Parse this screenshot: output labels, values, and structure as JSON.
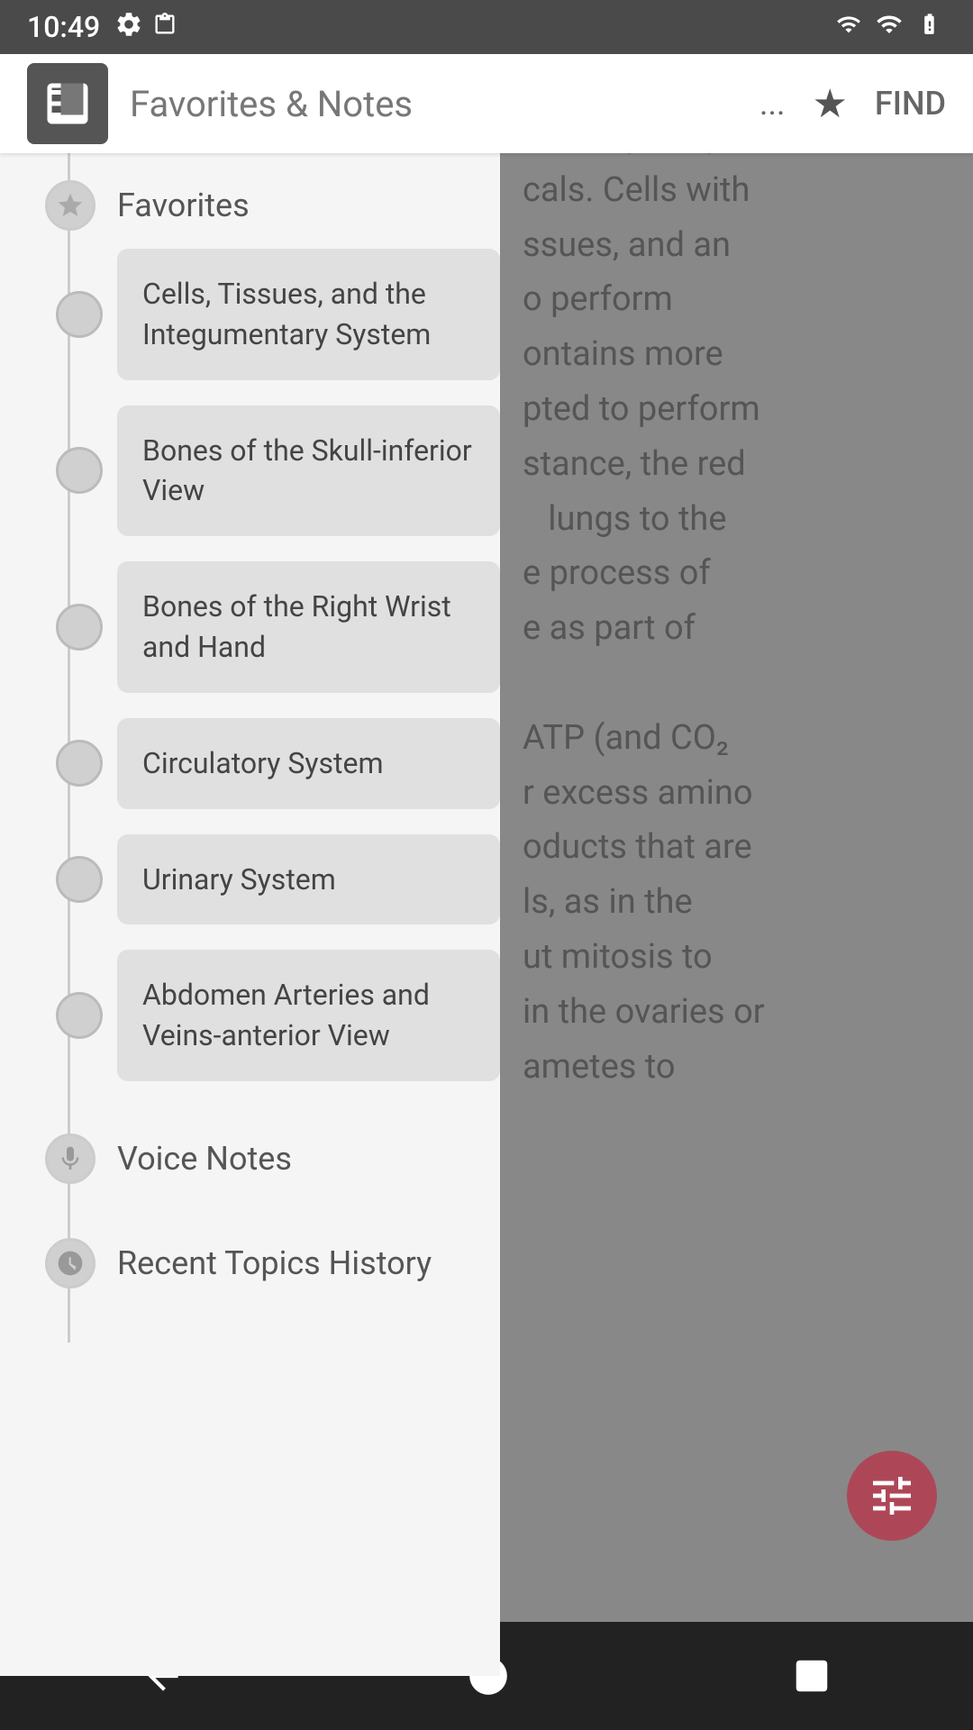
{
  "statusBar": {
    "time": "10:49",
    "icons": [
      "settings",
      "clipboard",
      "wifi",
      "signal",
      "battery"
    ]
  },
  "header": {
    "title": "Favorites & Notes",
    "moreLabel": "...",
    "findLabel": "FIND"
  },
  "sidebar": {
    "favoritesLabel": "Favorites",
    "items": [
      {
        "id": "item-1",
        "label": "Cells, Tissues, and the Integumentary System"
      },
      {
        "id": "item-2",
        "label": "Bones of the Skull-inferior View"
      },
      {
        "id": "item-3",
        "label": "Bones of the Right Wrist and Hand"
      },
      {
        "id": "item-4",
        "label": "Circulatory System"
      },
      {
        "id": "item-5",
        "label": "Urinary System"
      },
      {
        "id": "item-6",
        "label": "Abdomen Arteries and Veins-anterior View"
      }
    ],
    "voiceNotesLabel": "Voice Notes",
    "recentTopicsLabel": "Recent Topics History"
  },
  "bgContent": {
    "lines": [
      "he body; they are",
      "cals. Cells with",
      "issues, and an",
      "o perform",
      "ontains more",
      "pted to perform",
      "stance, the red",
      "lungs to the",
      "e process of",
      "e as part of",
      "ATP (and CO₂",
      "r excess amino",
      "oducts that are",
      "ls, as in the",
      "ut mitosis to",
      "in the ovaries or",
      "ametes to"
    ]
  },
  "bottomNav": {
    "backLabel": "◀",
    "homeLabel": "●",
    "recentLabel": "■"
  }
}
